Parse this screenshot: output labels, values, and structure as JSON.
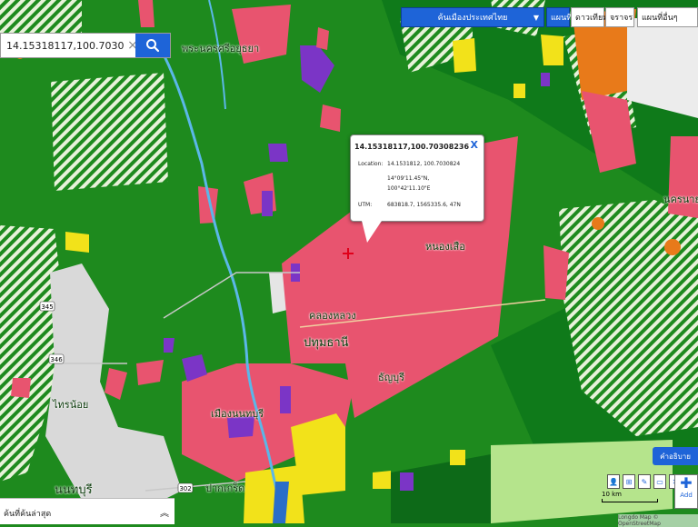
{
  "search": {
    "value": "14.15318117,100.70308236",
    "clear_icon": "×",
    "button_icon": "search-icon"
  },
  "header": {
    "country_select": "ค้นเมืองประเทศไทย",
    "tab_map": "แผนที่",
    "tab_satellite": "ดาวเทียม",
    "tab_traffic": "จราจร",
    "tab_layers": "แผนที่อื่นๆ"
  },
  "popup": {
    "title": "14.15318117,100.70308236",
    "close_icon": "X",
    "location_label": "Location:",
    "location_value": "14.1531812, 100.7030824",
    "dms_lat": "14°09'11.45\"N,",
    "dms_lon": "100°42'11.10\"E",
    "utm_label": "UTM:",
    "utm_value": "683818.7, 1565335.6, 47N"
  },
  "map_labels": {
    "l1": "พระนครศรีอยุธยา",
    "l2": "หนองเสือ",
    "l3": "คลองหลวง",
    "l4": "ปทุมธานี",
    "l5": "ธัญบุรี",
    "l6": "ไทรน้อย",
    "l7": "นนทบุรี",
    "l8": "ปากเกร็ด",
    "l9": "นครนายก",
    "l10": "เมืองนนทบุรี",
    "road1": "345",
    "road2": "346",
    "road3": "302"
  },
  "legend_button": "คำอธิบาย",
  "tools": [
    "👤",
    "⊞",
    "✎",
    "▭",
    "✕"
  ],
  "add_label": "Add",
  "scale": "10 km",
  "credit": "Longdo Map © OpenStreetMap",
  "recent": {
    "label": "ค้นที่ค้นล่าสุด",
    "toggle_icon": "chevron-up-icon"
  },
  "colors": {
    "agri": "#1e8a1e",
    "urban": "#e8546f",
    "industrial": "#7b35c6",
    "commercial": "#f2e21a",
    "forest_hatch": "#9ccc5a",
    "water": "#5bb7e8",
    "accent": "#1e64d8"
  }
}
